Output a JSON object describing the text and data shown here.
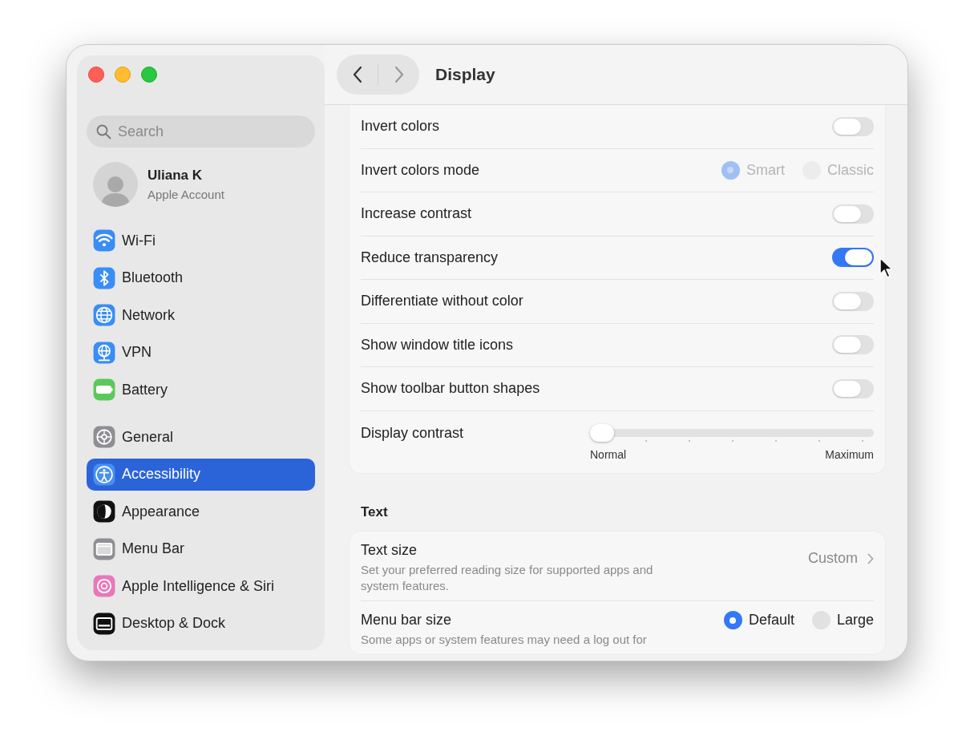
{
  "window": {
    "title": "Display"
  },
  "sidebar": {
    "search": {
      "placeholder": "Search"
    },
    "account": {
      "name": "Uliana K",
      "subtitle": "Apple Account"
    },
    "groups": [
      [
        {
          "label": "Wi-Fi",
          "selected": false
        },
        {
          "label": "Bluetooth",
          "selected": false
        },
        {
          "label": "Network",
          "selected": false
        },
        {
          "label": "VPN",
          "selected": false
        },
        {
          "label": "Battery",
          "selected": false
        }
      ],
      [
        {
          "label": "General",
          "selected": false
        },
        {
          "label": "Accessibility",
          "selected": true
        },
        {
          "label": "Appearance",
          "selected": false
        },
        {
          "label": "Menu Bar",
          "selected": false
        },
        {
          "label": "Apple Intelligence & Siri",
          "selected": false
        },
        {
          "label": "Desktop & Dock",
          "selected": false
        }
      ]
    ]
  },
  "display_settings": [
    {
      "kind": "toggle",
      "label": "Invert colors",
      "on": false
    },
    {
      "kind": "radio",
      "label": "Invert colors mode",
      "disabled": true,
      "options": [
        {
          "label": "Smart",
          "selected": true
        },
        {
          "label": "Classic",
          "selected": false
        }
      ]
    },
    {
      "kind": "toggle",
      "label": "Increase contrast",
      "on": false
    },
    {
      "kind": "toggle",
      "label": "Reduce transparency",
      "on": true
    },
    {
      "kind": "toggle",
      "label": "Differentiate without color",
      "on": false
    },
    {
      "kind": "toggle",
      "label": "Show window title icons",
      "on": false
    },
    {
      "kind": "toggle",
      "label": "Show toolbar button shapes",
      "on": false
    },
    {
      "kind": "slider",
      "label": "Display contrast",
      "level": 0,
      "min_label": "Normal",
      "max_label": "Maximum"
    }
  ],
  "text_section": {
    "title": "Text",
    "settings": [
      {
        "kind": "link",
        "label": "Text size",
        "description": "Set your preferred reading size for supported apps and system features.",
        "value": "Custom"
      },
      {
        "kind": "radio",
        "label": "Menu bar size",
        "description": "Some apps or system features may need a log out for",
        "disabled": false,
        "options": [
          {
            "label": "Default",
            "selected": true
          },
          {
            "label": "Large",
            "selected": false
          }
        ]
      }
    ]
  }
}
